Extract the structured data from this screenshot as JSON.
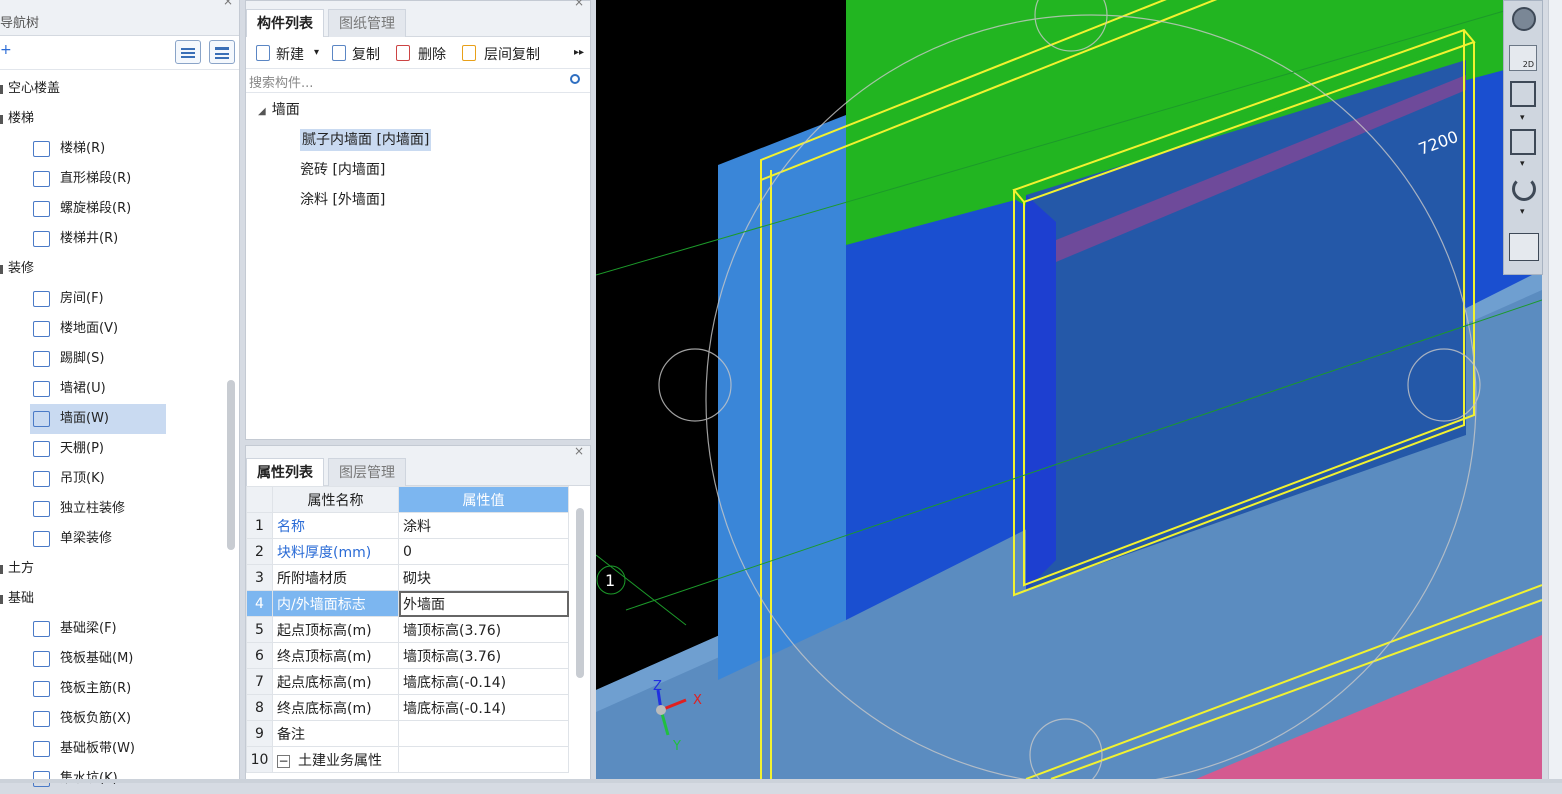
{
  "nav": {
    "title": "导航树",
    "groups": [
      {
        "label": "空心楼盖"
      },
      {
        "label": "楼梯",
        "items": [
          "楼梯(R)",
          "直形梯段(R)",
          "螺旋梯段(R)",
          "楼梯井(R)"
        ]
      },
      {
        "label": "装修",
        "items": [
          "房间(F)",
          "楼地面(V)",
          "踢脚(S)",
          "墙裙(U)",
          "墙面(W)",
          "天棚(P)",
          "吊顶(K)",
          "独立柱装修",
          "单梁装修"
        ]
      },
      {
        "label": "土方"
      },
      {
        "label": "基础",
        "items": [
          "基础梁(F)",
          "筏板基础(M)",
          "筏板主筋(R)",
          "筏板负筋(X)",
          "基础板带(W)",
          "集水坑(K)"
        ]
      }
    ],
    "selected": "墙面(W)"
  },
  "components": {
    "tabs": [
      "构件列表",
      "图纸管理"
    ],
    "toolbar": {
      "new": "新建",
      "copy": "复制",
      "delete": "删除",
      "floor_copy": "层间复制",
      "more": "▸▸"
    },
    "search_placeholder": "搜索构件...",
    "category": "墙面",
    "items": [
      "腻子内墙面 [内墙面]",
      "瓷砖 [内墙面]",
      "涂料 [外墙面]"
    ],
    "selected_index": 0
  },
  "properties": {
    "tabs": [
      "属性列表",
      "图层管理"
    ],
    "col_name": "属性名称",
    "col_value": "属性值",
    "rows": [
      {
        "n": "1",
        "name": "名称",
        "value": "涂料",
        "blue": true
      },
      {
        "n": "2",
        "name": "块料厚度(mm)",
        "value": "0",
        "blue": true
      },
      {
        "n": "3",
        "name": "所附墙材质",
        "value": "砌块",
        "blue": false
      },
      {
        "n": "4",
        "name": "内/外墙面标志",
        "value": "外墙面",
        "blue": true
      },
      {
        "n": "5",
        "name": "起点顶标高(m)",
        "value": "墙顶标高(3.76)",
        "blue": false
      },
      {
        "n": "6",
        "name": "终点顶标高(m)",
        "value": "墙顶标高(3.76)",
        "blue": false
      },
      {
        "n": "7",
        "name": "起点底标高(m)",
        "value": "墙底标高(-0.14)",
        "blue": false
      },
      {
        "n": "8",
        "name": "终点底标高(m)",
        "value": "墙底标高(-0.14)",
        "blue": false
      },
      {
        "n": "9",
        "name": "备注",
        "value": "",
        "blue": false
      },
      {
        "n": "10",
        "name": "土建业务属性",
        "value": "",
        "blue": false,
        "collapse": "−"
      }
    ],
    "current_row": 3
  },
  "viewport": {
    "dimension_label": "7200",
    "axis_label": "1",
    "axes": {
      "x": "X",
      "y": "Y",
      "z": "Z"
    },
    "view_tool_2d": "2D"
  },
  "colors": {
    "wall_blue": "#1a4fd0",
    "slab_green": "#22b521",
    "floor_steel": "#4f86c2",
    "pink": "#d45a90",
    "selection_yellow": "#f2f230"
  }
}
